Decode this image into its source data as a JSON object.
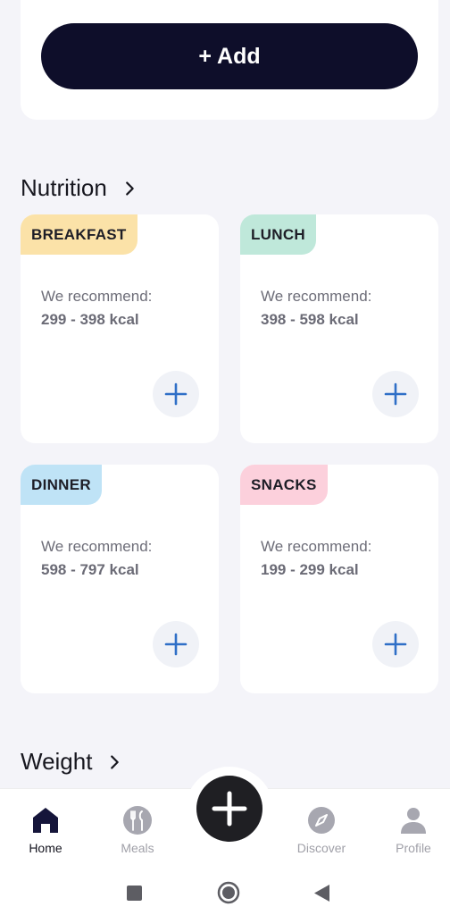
{
  "top": {
    "add_label": "+ Add"
  },
  "nutrition": {
    "title": "Nutrition",
    "meals": [
      {
        "name": "BREAKFAST",
        "tag_color": "#fbe2a8",
        "rec_label": "We recommend:",
        "range": "299 - 398 kcal"
      },
      {
        "name": "LUNCH",
        "tag_color": "#bfe8da",
        "rec_label": "We recommend:",
        "range": "398 - 598 kcal"
      },
      {
        "name": "DINNER",
        "tag_color": "#bfe3f6",
        "rec_label": "We recommend:",
        "range": "598 - 797 kcal"
      },
      {
        "name": "SNACKS",
        "tag_color": "#fcd0dc",
        "rec_label": "We recommend:",
        "range": "199 - 299 kcal"
      }
    ]
  },
  "weight": {
    "title": "Weight"
  },
  "nav": {
    "items": [
      {
        "label": "Home",
        "icon": "home-icon",
        "active": true
      },
      {
        "label": "Meals",
        "icon": "utensils-icon",
        "active": false
      },
      {
        "label": "Discover",
        "icon": "compass-icon",
        "active": false
      },
      {
        "label": "Profile",
        "icon": "user-icon",
        "active": false
      }
    ],
    "fab_icon": "plus-icon"
  },
  "colors": {
    "background": "#f4f4f9",
    "primary_dark": "#0e0e2a",
    "accent_blue": "#2f6fc7"
  }
}
